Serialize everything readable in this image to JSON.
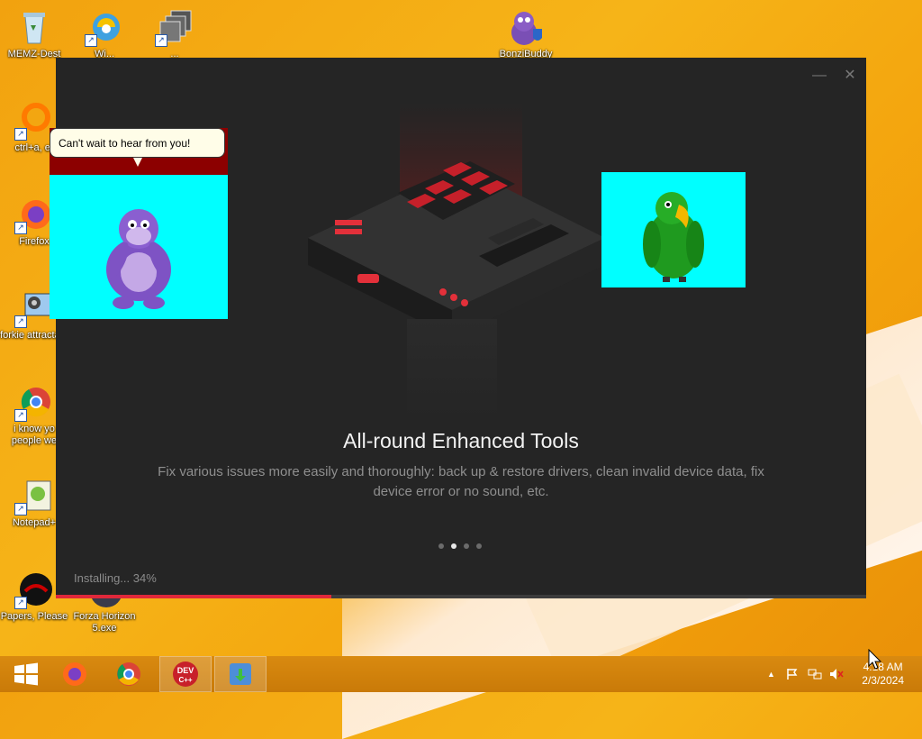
{
  "desktop": {
    "icons": [
      {
        "label": "MEMZ-Dest",
        "icon": "recycle-bin-icon"
      },
      {
        "label": "Wi...",
        "icon": "browser-icon"
      },
      {
        "label": "...",
        "icon": "stacked-windows-icon"
      },
      {
        "label": "BonziBuddy",
        "icon": "bonzi-icon"
      },
      {
        "label": "ctrl+a, er",
        "icon": "orange-ring-icon"
      },
      {
        "label": "Firefox",
        "icon": "firefox-icon"
      },
      {
        "label": "forkie attractant",
        "icon": "settings-monitor-icon"
      },
      {
        "label": "i know yo people we",
        "icon": "chrome-icon"
      },
      {
        "label": "Notepad+",
        "icon": "notepad-plus-icon"
      },
      {
        "label": "Papers, Please",
        "icon": "papers-please-icon"
      },
      {
        "label": "Forza Horizon 5.exe",
        "icon": "forza-icon"
      }
    ]
  },
  "installer": {
    "minimize": "—",
    "close": "✕",
    "title": "All-round Enhanced Tools",
    "description": "Fix various issues more easily and thoroughly: back up & restore drivers, clean invalid device data, fix device error or no sound, etc.",
    "slides": 4,
    "active_slide": 1,
    "status": "Installing... 34%",
    "progress": 0.34,
    "accent": "#e0283a"
  },
  "bonzi": {
    "speech": "Can't wait to hear from you!"
  },
  "taskbar": {
    "apps": [
      "start-icon",
      "firefox-icon",
      "chrome-icon",
      "devcpp-icon",
      "iobit-icon"
    ],
    "time": "4:18 AM",
    "date": "2/3/2024"
  }
}
